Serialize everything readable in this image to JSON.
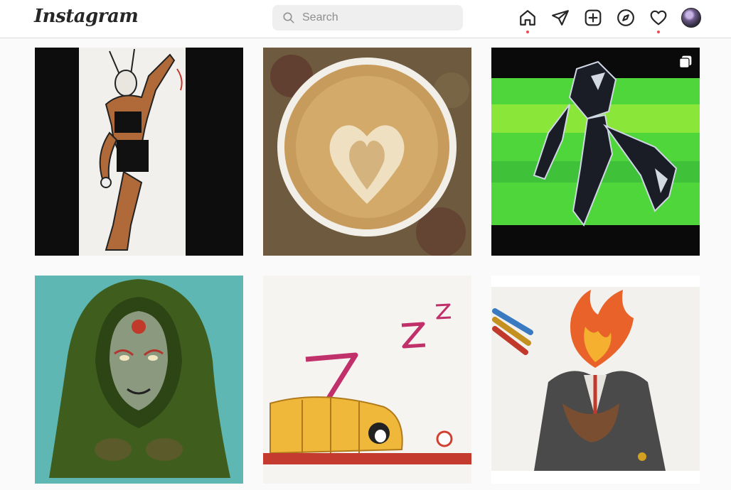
{
  "header": {
    "logo_text": "Instagram",
    "search": {
      "placeholder": "Search",
      "value": ""
    },
    "nav_icons": [
      "home-icon",
      "direct-icon",
      "new-post-icon",
      "explore-icon",
      "activity-icon",
      "profile-avatar"
    ],
    "notification_color": "#ed4956"
  },
  "grid": {
    "posts": [
      {
        "subject": "rabbit-girl-kick-drawing",
        "multi": false
      },
      {
        "subject": "latte-art-heart",
        "multi": false
      },
      {
        "subject": "robot-creature-green-art",
        "multi": true
      },
      {
        "subject": "hooded-green-mask-figure",
        "multi": false
      },
      {
        "subject": "sleeping-bag-zzz-drawing",
        "multi": false
      },
      {
        "subject": "flame-head-suit-drawing",
        "multi": false
      }
    ]
  }
}
